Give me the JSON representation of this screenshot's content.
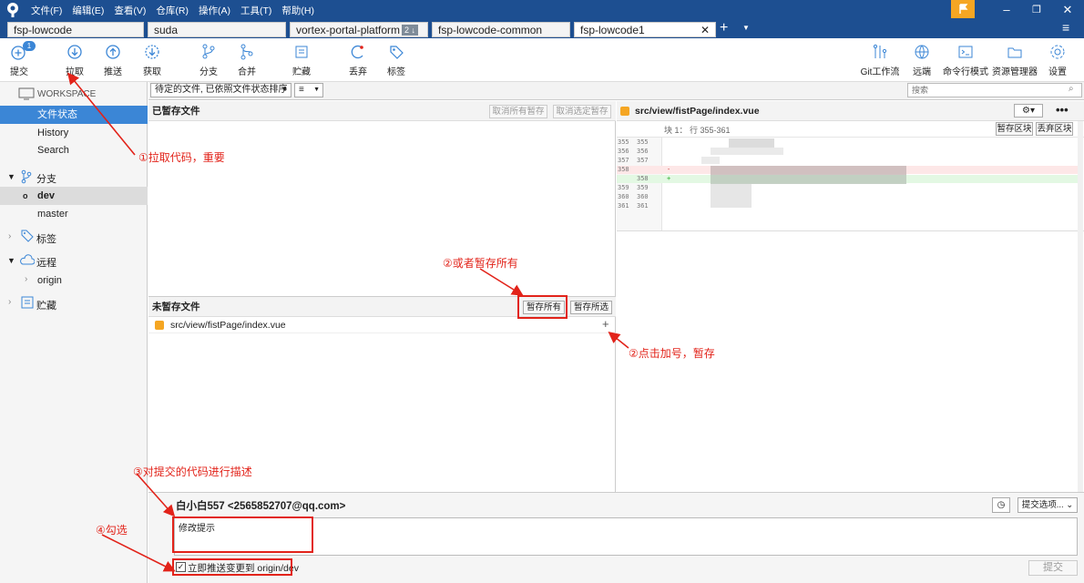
{
  "titlebar": {
    "menus": [
      "文件(F)",
      "编辑(E)",
      "查看(V)",
      "仓库(R)",
      "操作(A)",
      "工具(T)",
      "帮助(H)"
    ],
    "window_controls": [
      "minimize-icon",
      "restore-icon",
      "close-icon"
    ]
  },
  "tabs": [
    {
      "label": "fsp-lowcode"
    },
    {
      "label": "suda"
    },
    {
      "label": "vortex-portal-platform",
      "badge": "2 ↓"
    },
    {
      "label": "fsp-lowcode-common"
    },
    {
      "label": "fsp-lowcode1",
      "active": true
    }
  ],
  "toolbar": {
    "left": [
      {
        "label": "提交",
        "icon": "commit-icon",
        "badge": "1"
      },
      {
        "label": "拉取",
        "icon": "pull-icon"
      },
      {
        "label": "推送",
        "icon": "push-icon"
      },
      {
        "label": "获取",
        "icon": "fetch-icon"
      },
      {
        "label": "分支",
        "icon": "branch-icon"
      },
      {
        "label": "合并",
        "icon": "merge-icon"
      },
      {
        "label": "贮藏",
        "icon": "stash-icon"
      },
      {
        "label": "丢弃",
        "icon": "discard-icon"
      },
      {
        "label": "标签",
        "icon": "tag-icon"
      }
    ],
    "right": [
      {
        "label": "Git工作流",
        "icon": "git-flow-icon"
      },
      {
        "label": "远端",
        "icon": "remote-icon"
      },
      {
        "label": "命令行模式",
        "icon": "terminal-icon"
      },
      {
        "label": "资源管理器",
        "icon": "explorer-icon"
      },
      {
        "label": "设置",
        "icon": "settings-icon"
      }
    ]
  },
  "sidebar": {
    "workspace": "WORKSPACE",
    "workspace_items": [
      "文件状态",
      "History",
      "Search"
    ],
    "branches_label": "分支",
    "branches": [
      "dev",
      "master"
    ],
    "tags_label": "标签",
    "remotes_label": "远程",
    "remotes": [
      "origin"
    ],
    "stashes_label": "贮藏"
  },
  "filter": {
    "sort_label": "待定的文件, 已依照文件状态排序",
    "view_icon": "≡",
    "search_placeholder": "搜索"
  },
  "staged": {
    "title": "已暂存文件",
    "unstage_all": "取消所有暂存",
    "unstage_selected": "取消选定暂存"
  },
  "unstaged": {
    "title": "未暂存文件",
    "stage_all": "暂存所有",
    "stage_selected": "暂存所选",
    "files": [
      {
        "path": "src/view/fistPage/index.vue"
      }
    ]
  },
  "diff": {
    "file": "src/view/fistPage/index.vue",
    "hunk_label": "块 1： 行 355-361",
    "stage_hunk": "暂存区块",
    "discard_hunk": "丢弃区块",
    "lines": [
      {
        "old": "355",
        "new": "355",
        "mark": "",
        "type": "ctx"
      },
      {
        "old": "356",
        "new": "356",
        "mark": "",
        "type": "ctx"
      },
      {
        "old": "357",
        "new": "357",
        "mark": "",
        "type": "ctx"
      },
      {
        "old": "358",
        "new": "",
        "mark": "-",
        "type": "del"
      },
      {
        "old": "",
        "new": "358",
        "mark": "+",
        "type": "add"
      },
      {
        "old": "359",
        "new": "359",
        "mark": "",
        "type": "ctx"
      },
      {
        "old": "360",
        "new": "360",
        "mark": "",
        "type": "ctx"
      },
      {
        "old": "361",
        "new": "361",
        "mark": "",
        "type": "ctx"
      }
    ]
  },
  "commit": {
    "author": "白小白557 <2565852707@qq.com>",
    "message": "修改提示",
    "options_label": "提交选项...",
    "push_label": "立即推送变更到 origin/dev",
    "push_checked": true,
    "submit_label": "提交"
  },
  "annotations": {
    "a1": "①拉取代码，重要",
    "a2a": "②或者暂存所有",
    "a2b": "②点击加号，暂存",
    "a3": "③对提交的代码进行描述",
    "a4": "④勾选"
  }
}
